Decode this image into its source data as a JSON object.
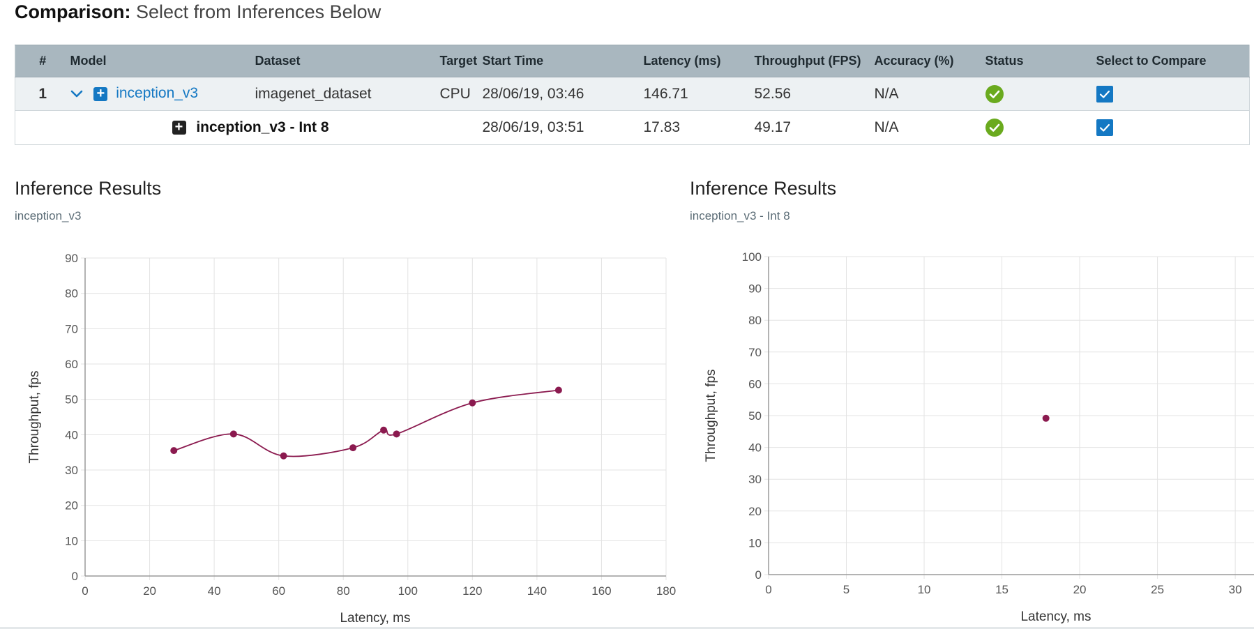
{
  "header": {
    "title_bold": "Comparison:",
    "title_rest": "Select from Inferences Below"
  },
  "table": {
    "columns": [
      "#",
      "Model",
      "Dataset",
      "Target",
      "Start Time",
      "Latency (ms)",
      "Throughput (FPS)",
      "Accuracy (%)",
      "Status",
      "Select to Compare"
    ],
    "rows": [
      {
        "num": "1",
        "model": "inception_v3",
        "dataset": "imagenet_dataset",
        "target": "CPU",
        "start_time": "28/06/19, 03:46",
        "latency": "146.71",
        "throughput": "52.56",
        "accuracy": "N/A",
        "status_icon": "check-circle-icon",
        "selected": true
      },
      {
        "num": "",
        "model": "inception_v3 - Int 8",
        "dataset": "",
        "target": "",
        "start_time": "28/06/19, 03:51",
        "latency": "17.83",
        "throughput": "49.17",
        "accuracy": "N/A",
        "status_icon": "check-circle-icon",
        "selected": true
      }
    ]
  },
  "colors": {
    "accent": "#1478c3",
    "header_bg": "#a9b7bf",
    "row_bg": "#edf1f3",
    "status_green": "#6aaa1e",
    "series": "#8b1a4f"
  },
  "charts": [
    {
      "title": "Inference Results",
      "subtitle": "inception_v3"
    },
    {
      "title": "Inference Results",
      "subtitle": "inception_v3 - Int 8"
    }
  ],
  "chart_data": [
    {
      "type": "line",
      "xlabel": "Latency, ms",
      "ylabel": "Throughput, fps",
      "xlim": [
        0,
        180
      ],
      "ylim": [
        0,
        90
      ],
      "xticks": [
        0,
        20,
        40,
        60,
        80,
        100,
        120,
        140,
        160,
        180
      ],
      "yticks": [
        0,
        10,
        20,
        30,
        40,
        50,
        60,
        70,
        80,
        90
      ],
      "grid": true,
      "series": [
        {
          "points": [
            [
              27.5,
              35.5
            ],
            [
              46,
              40.2
            ],
            [
              61.5,
              34
            ],
            [
              83,
              36.3
            ],
            [
              92.5,
              41.3
            ],
            [
              96.5,
              40.2
            ],
            [
              120,
              49
            ],
            [
              146.7,
              52.6
            ]
          ]
        }
      ]
    },
    {
      "type": "scatter",
      "xlabel": "Latency, ms",
      "ylabel": "Throughput, fps",
      "xlim": [
        0,
        33
      ],
      "ylim": [
        0,
        100
      ],
      "xticks": [
        0,
        5,
        10,
        15,
        20,
        25,
        30
      ],
      "yticks": [
        0,
        10,
        20,
        30,
        40,
        50,
        60,
        70,
        80,
        90,
        100
      ],
      "grid": true,
      "series": [
        {
          "points": [
            [
              17.83,
              49.17
            ]
          ]
        }
      ]
    }
  ]
}
